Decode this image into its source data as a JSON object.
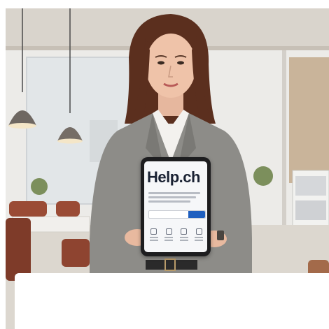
{
  "photo": {
    "description_icon": "photo-image",
    "tablet": {
      "brand": "Help.ch"
    }
  },
  "colors": {
    "background": "#ffffff",
    "tablet_accent": "#1f5fbf"
  }
}
